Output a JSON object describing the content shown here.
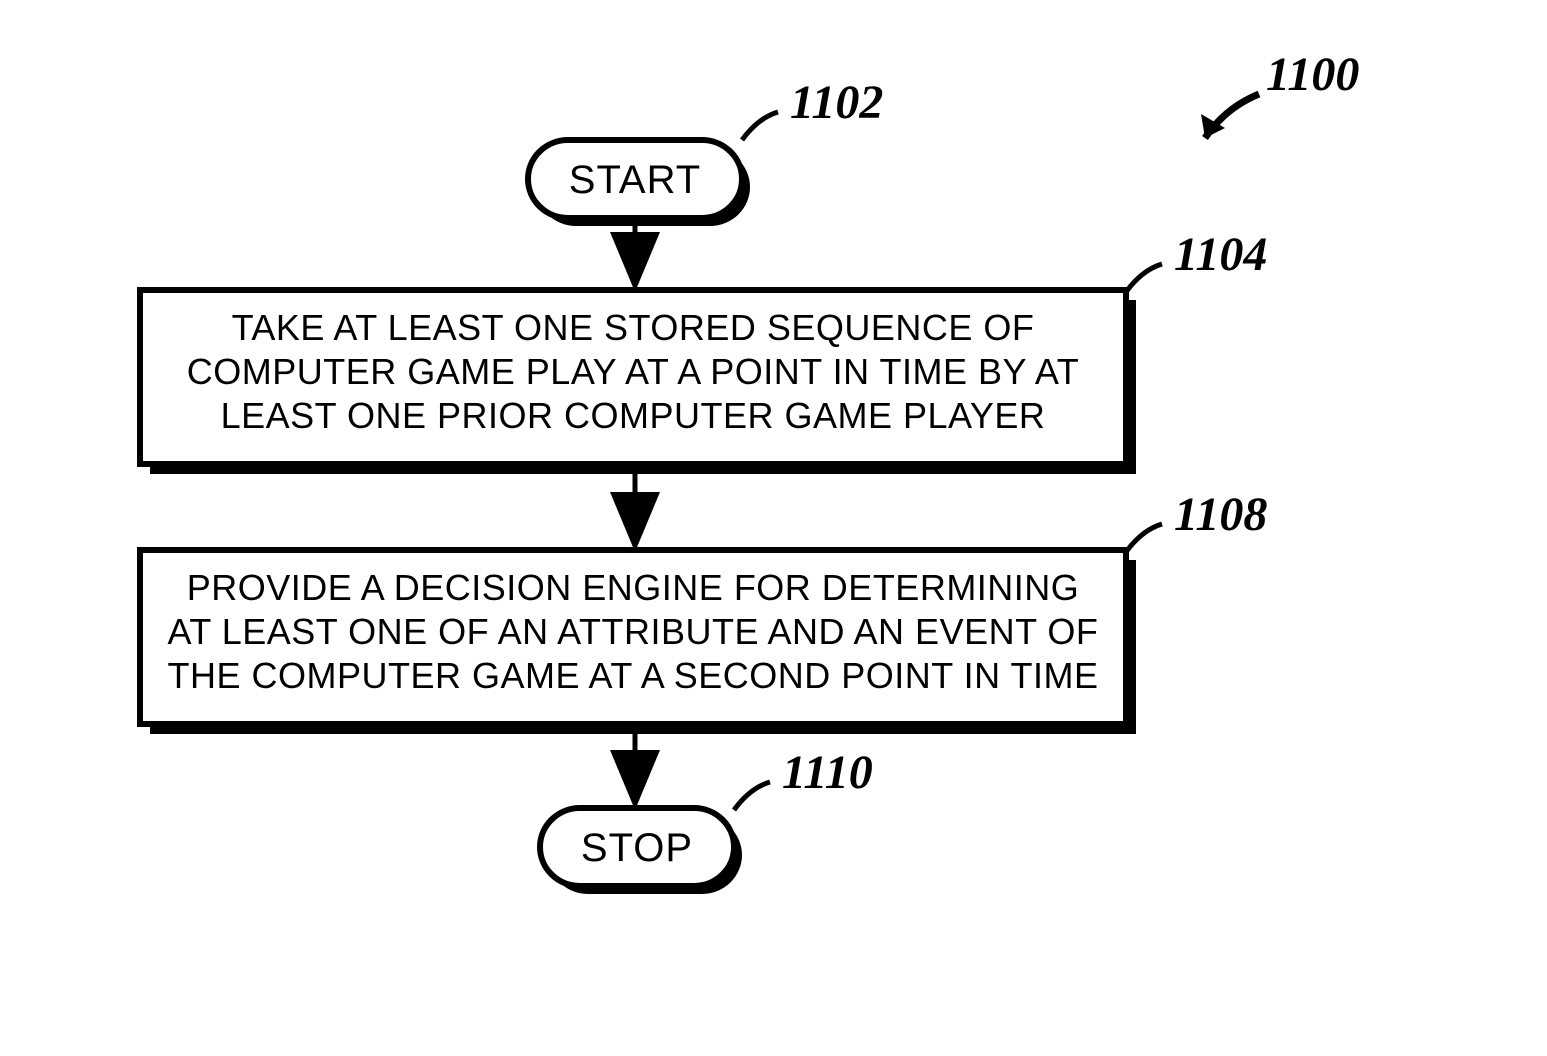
{
  "refs": {
    "overall": "1100",
    "start": "1102",
    "step1": "1104",
    "step2": "1108",
    "stop": "1110"
  },
  "nodes": {
    "start": "START",
    "stop": "STOP",
    "step1_l1": "TAKE AT LEAST ONE STORED SEQUENCE OF",
    "step1_l2": "COMPUTER GAME PLAY AT A POINT IN TIME BY AT",
    "step1_l3": "LEAST ONE PRIOR COMPUTER GAME PLAYER",
    "step2_l1": "PROVIDE A DECISION ENGINE FOR DETERMINING",
    "step2_l2": "AT LEAST ONE OF AN ATTRIBUTE AND AN EVENT OF",
    "step2_l3": "THE COMPUTER GAME AT A SECOND POINT IN TIME"
  }
}
